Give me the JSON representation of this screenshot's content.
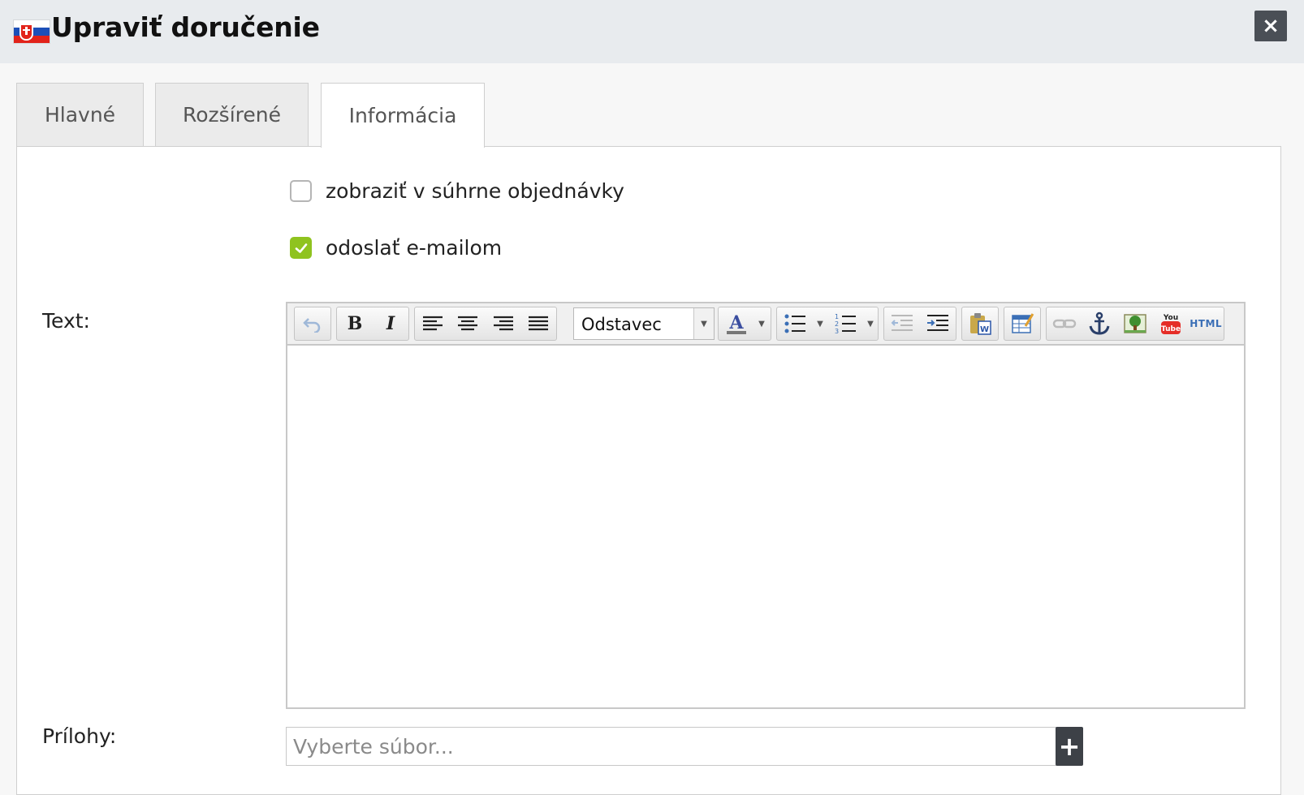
{
  "dialog": {
    "title": "Upraviť doručenie",
    "flag_icon": "slovakia-flag-icon",
    "close_label": "×"
  },
  "tabs": [
    {
      "label": "Hlavné",
      "active": false
    },
    {
      "label": "Rozšírené",
      "active": false
    },
    {
      "label": "Informácia",
      "active": true
    }
  ],
  "options": {
    "show_in_summary": {
      "label": "zobraziť v súhrne objednávky",
      "checked": false
    },
    "send_email": {
      "label": "odoslať e-mailom",
      "checked": true
    }
  },
  "editor": {
    "label": "Text:",
    "format_value": "Odstavec",
    "content": "",
    "toolbar_icons": [
      "undo-icon",
      "bold-icon",
      "italic-icon",
      "align-left-icon",
      "align-center-icon",
      "align-right-icon",
      "align-justify-icon",
      "font-color-icon",
      "bullet-list-icon",
      "numbered-list-icon",
      "outdent-icon",
      "indent-icon",
      "paste-word-icon",
      "insert-table-icon",
      "link-icon",
      "anchor-icon",
      "insert-image-icon",
      "youtube-icon",
      "html-source-icon"
    ]
  },
  "attachments": {
    "label": "Prílohy:",
    "placeholder": "Vyberte súbor...",
    "add_label": "+"
  },
  "colors": {
    "header_bg": "#e8ebee",
    "checkbox_checked": "#8fc31f",
    "close_button": "#4a4f56"
  }
}
